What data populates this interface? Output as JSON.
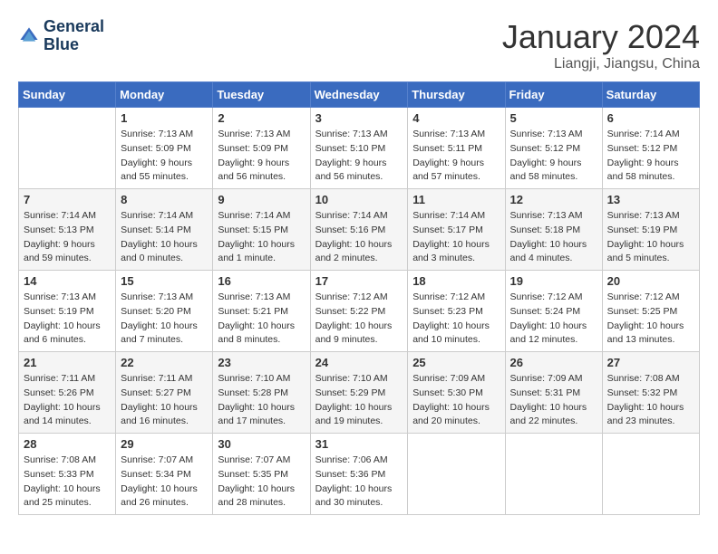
{
  "logo": {
    "line1": "General",
    "line2": "Blue"
  },
  "title": "January 2024",
  "location": "Liangji, Jiangsu, China",
  "days_header": [
    "Sunday",
    "Monday",
    "Tuesday",
    "Wednesday",
    "Thursday",
    "Friday",
    "Saturday"
  ],
  "weeks": [
    [
      {
        "day": "",
        "info": ""
      },
      {
        "day": "1",
        "info": "Sunrise: 7:13 AM\nSunset: 5:09 PM\nDaylight: 9 hours\nand 55 minutes."
      },
      {
        "day": "2",
        "info": "Sunrise: 7:13 AM\nSunset: 5:09 PM\nDaylight: 9 hours\nand 56 minutes."
      },
      {
        "day": "3",
        "info": "Sunrise: 7:13 AM\nSunset: 5:10 PM\nDaylight: 9 hours\nand 56 minutes."
      },
      {
        "day": "4",
        "info": "Sunrise: 7:13 AM\nSunset: 5:11 PM\nDaylight: 9 hours\nand 57 minutes."
      },
      {
        "day": "5",
        "info": "Sunrise: 7:13 AM\nSunset: 5:12 PM\nDaylight: 9 hours\nand 58 minutes."
      },
      {
        "day": "6",
        "info": "Sunrise: 7:14 AM\nSunset: 5:12 PM\nDaylight: 9 hours\nand 58 minutes."
      }
    ],
    [
      {
        "day": "7",
        "info": "Sunrise: 7:14 AM\nSunset: 5:13 PM\nDaylight: 9 hours\nand 59 minutes."
      },
      {
        "day": "8",
        "info": "Sunrise: 7:14 AM\nSunset: 5:14 PM\nDaylight: 10 hours\nand 0 minutes."
      },
      {
        "day": "9",
        "info": "Sunrise: 7:14 AM\nSunset: 5:15 PM\nDaylight: 10 hours\nand 1 minute."
      },
      {
        "day": "10",
        "info": "Sunrise: 7:14 AM\nSunset: 5:16 PM\nDaylight: 10 hours\nand 2 minutes."
      },
      {
        "day": "11",
        "info": "Sunrise: 7:14 AM\nSunset: 5:17 PM\nDaylight: 10 hours\nand 3 minutes."
      },
      {
        "day": "12",
        "info": "Sunrise: 7:13 AM\nSunset: 5:18 PM\nDaylight: 10 hours\nand 4 minutes."
      },
      {
        "day": "13",
        "info": "Sunrise: 7:13 AM\nSunset: 5:19 PM\nDaylight: 10 hours\nand 5 minutes."
      }
    ],
    [
      {
        "day": "14",
        "info": "Sunrise: 7:13 AM\nSunset: 5:19 PM\nDaylight: 10 hours\nand 6 minutes."
      },
      {
        "day": "15",
        "info": "Sunrise: 7:13 AM\nSunset: 5:20 PM\nDaylight: 10 hours\nand 7 minutes."
      },
      {
        "day": "16",
        "info": "Sunrise: 7:13 AM\nSunset: 5:21 PM\nDaylight: 10 hours\nand 8 minutes."
      },
      {
        "day": "17",
        "info": "Sunrise: 7:12 AM\nSunset: 5:22 PM\nDaylight: 10 hours\nand 9 minutes."
      },
      {
        "day": "18",
        "info": "Sunrise: 7:12 AM\nSunset: 5:23 PM\nDaylight: 10 hours\nand 10 minutes."
      },
      {
        "day": "19",
        "info": "Sunrise: 7:12 AM\nSunset: 5:24 PM\nDaylight: 10 hours\nand 12 minutes."
      },
      {
        "day": "20",
        "info": "Sunrise: 7:12 AM\nSunset: 5:25 PM\nDaylight: 10 hours\nand 13 minutes."
      }
    ],
    [
      {
        "day": "21",
        "info": "Sunrise: 7:11 AM\nSunset: 5:26 PM\nDaylight: 10 hours\nand 14 minutes."
      },
      {
        "day": "22",
        "info": "Sunrise: 7:11 AM\nSunset: 5:27 PM\nDaylight: 10 hours\nand 16 minutes."
      },
      {
        "day": "23",
        "info": "Sunrise: 7:10 AM\nSunset: 5:28 PM\nDaylight: 10 hours\nand 17 minutes."
      },
      {
        "day": "24",
        "info": "Sunrise: 7:10 AM\nSunset: 5:29 PM\nDaylight: 10 hours\nand 19 minutes."
      },
      {
        "day": "25",
        "info": "Sunrise: 7:09 AM\nSunset: 5:30 PM\nDaylight: 10 hours\nand 20 minutes."
      },
      {
        "day": "26",
        "info": "Sunrise: 7:09 AM\nSunset: 5:31 PM\nDaylight: 10 hours\nand 22 minutes."
      },
      {
        "day": "27",
        "info": "Sunrise: 7:08 AM\nSunset: 5:32 PM\nDaylight: 10 hours\nand 23 minutes."
      }
    ],
    [
      {
        "day": "28",
        "info": "Sunrise: 7:08 AM\nSunset: 5:33 PM\nDaylight: 10 hours\nand 25 minutes."
      },
      {
        "day": "29",
        "info": "Sunrise: 7:07 AM\nSunset: 5:34 PM\nDaylight: 10 hours\nand 26 minutes."
      },
      {
        "day": "30",
        "info": "Sunrise: 7:07 AM\nSunset: 5:35 PM\nDaylight: 10 hours\nand 28 minutes."
      },
      {
        "day": "31",
        "info": "Sunrise: 7:06 AM\nSunset: 5:36 PM\nDaylight: 10 hours\nand 30 minutes."
      },
      {
        "day": "",
        "info": ""
      },
      {
        "day": "",
        "info": ""
      },
      {
        "day": "",
        "info": ""
      }
    ]
  ]
}
